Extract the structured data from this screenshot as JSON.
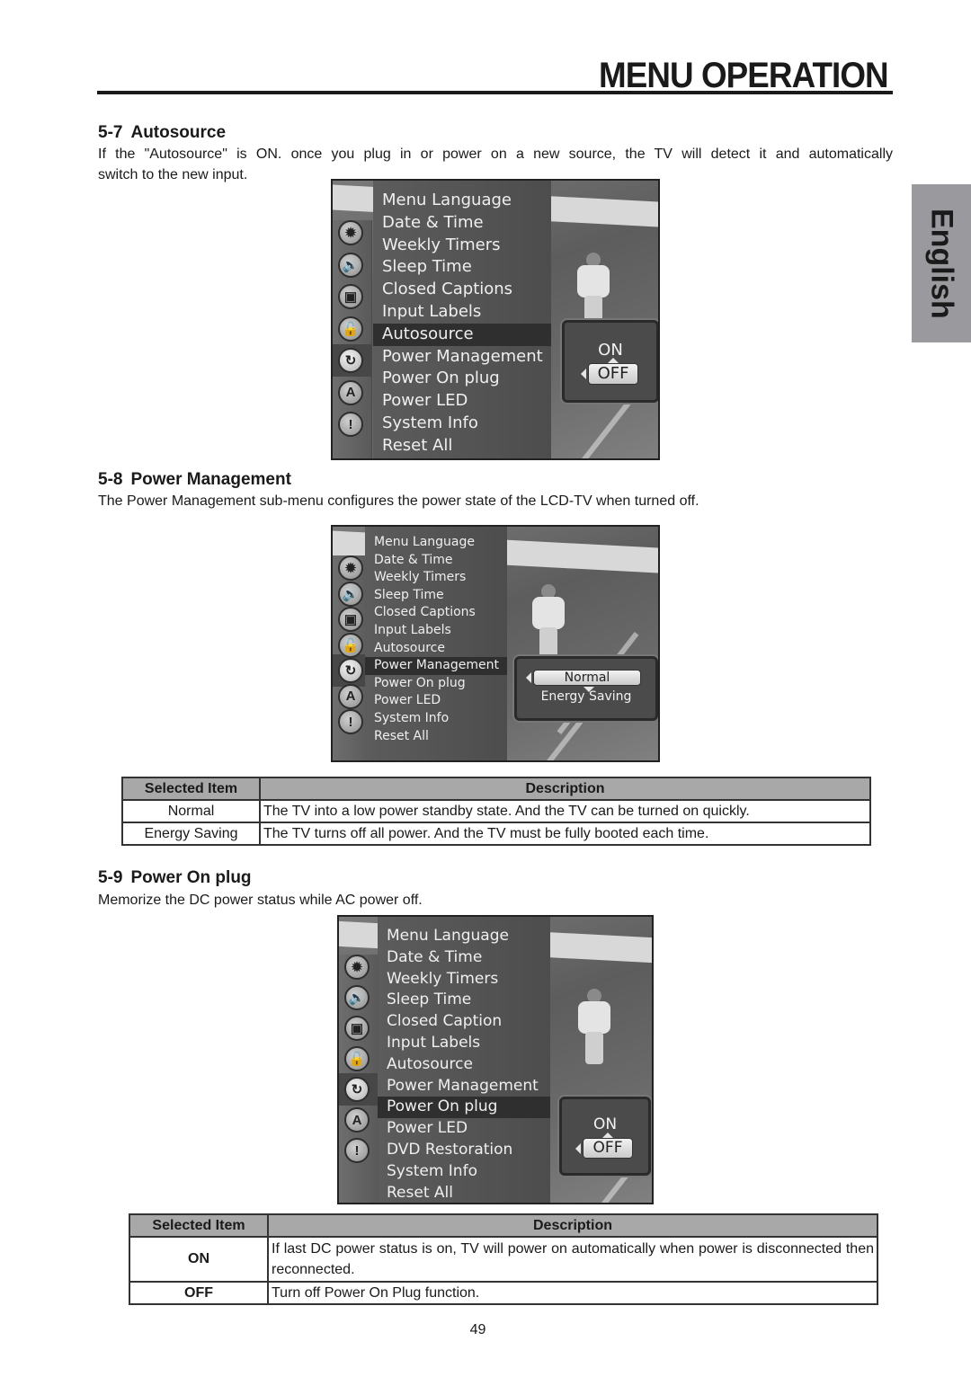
{
  "header": {
    "title": "MENU OPERATION"
  },
  "language_tab": "English",
  "sections": [
    {
      "number": "5-7",
      "title": "Autosource",
      "text": "If the \"Autosource\" is ON. once you plug in or power on a new source, the TV will detect it and automatically switch to the new input.",
      "text_line1": "If the \"Autosource\" is ON. once you plug in or power on a new source, the TV will detect it and automatically",
      "text_line2": "switch to the new input.",
      "screen": {
        "menu_items": [
          "Menu Language",
          "Date & Time",
          "Weekly Timers",
          "Sleep Time",
          "Closed Captions",
          "Input Labels",
          "Autosource",
          "Power Management",
          "Power On plug",
          "Power LED",
          "System Info",
          "Reset All"
        ],
        "selected_item": "Autosource",
        "popup_options": [
          "ON",
          "OFF"
        ],
        "popup_selected": "OFF"
      }
    },
    {
      "number": "5-8",
      "title": "Power Management",
      "text": "The Power Management sub-menu configures the power state of the LCD-TV when turned off.",
      "screen": {
        "menu_items": [
          "Menu Language",
          "Date & Time",
          "Weekly Timers",
          "Sleep Time",
          "Closed Captions",
          "Input Labels",
          "Autosource",
          "Power Management",
          "Power On plug",
          "Power LED",
          "System Info",
          "Reset All"
        ],
        "selected_item": "Power Management",
        "popup_options": [
          "Normal",
          "Energy Saving"
        ],
        "popup_selected": "Normal"
      },
      "table": {
        "headers": [
          "Selected Item",
          "Description"
        ],
        "rows": [
          [
            "Normal",
            "The TV into a low power standby state.  And the TV can be turned on quickly."
          ],
          [
            "Energy Saving",
            "The TV turns off all power.  And the TV must be fully booted each time."
          ]
        ]
      }
    },
    {
      "number": "5-9",
      "title": "Power On plug",
      "text": "Memorize the DC power status while AC power off.",
      "screen": {
        "menu_items": [
          "Menu Language",
          "Date & Time",
          "Weekly Timers",
          "Sleep Time",
          "Closed Caption",
          "Input Labels",
          "Autosource",
          "Power Management",
          "Power On plug",
          "Power LED",
          "DVD Restoration",
          "System Info",
          "Reset All"
        ],
        "selected_item": "Power On plug",
        "popup_options": [
          "ON",
          "OFF"
        ],
        "popup_selected": "OFF"
      },
      "table": {
        "headers": [
          "Selected Item",
          "Description"
        ],
        "rows": [
          [
            "ON",
            "If last DC power status is on, TV will power on automatically when power is disconnected then reconnected."
          ],
          [
            "OFF",
            "Turn off Power On Plug function."
          ]
        ]
      }
    }
  ],
  "icons": [
    "settings-icon",
    "audio-icon",
    "tv-icon",
    "lock-icon",
    "setup-icon",
    "language-icon",
    "info-icon"
  ],
  "icon_glyphs": [
    "✹",
    "🔊",
    "▣",
    "🔓",
    "↻",
    "A",
    "!"
  ],
  "page_number": "49"
}
